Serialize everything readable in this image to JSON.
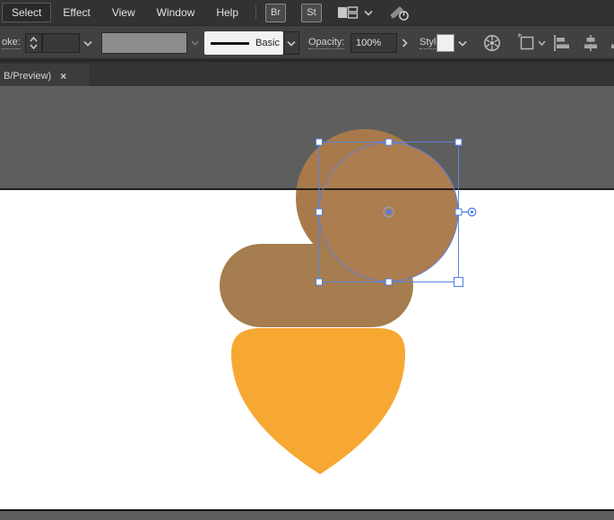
{
  "menu_bar": {
    "items": [
      {
        "label": "Select",
        "active": true
      },
      {
        "label": "Effect",
        "active": false
      },
      {
        "label": "View",
        "active": false
      },
      {
        "label": "Window",
        "active": false
      },
      {
        "label": "Help",
        "active": false
      }
    ],
    "bridge_badge": "Br",
    "stock_badge": "St"
  },
  "control_bar": {
    "stroke_label": "oke:",
    "stroke_width_value": "",
    "stroke_style_value": "Basic",
    "opacity_label": "Opacity:",
    "opacity_value": "100%",
    "style_label": "Style:"
  },
  "document_tab": {
    "title": "B/Preview)",
    "close_glyph": "×"
  },
  "icons": {
    "workspace_switcher": "workspace-layout",
    "gpu_performance": "rocket-power",
    "recolor_artwork": "color-wheel",
    "document_setup": "artboard-page",
    "align": [
      "horizontal-align-left",
      "horizontal-align-center",
      "horizontal-align-right"
    ]
  },
  "canvas": {
    "pasteboard_color": "#5e5e5e",
    "artboard_color": "#ffffff",
    "artboard_edge_color": "#161616"
  },
  "artwork": {
    "acorn_body_color": "#f7a832",
    "cap_color": "#a57d4e",
    "selected_circle_color": "#ac7d4f",
    "back_circle_color": "#a87a4b",
    "selection_color": "#4d7fe3"
  }
}
